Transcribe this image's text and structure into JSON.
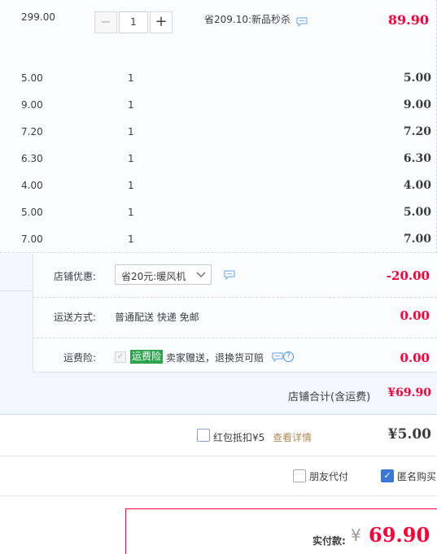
{
  "main_item": {
    "price": "299.00",
    "qty_minus": "−",
    "qty_value": "1",
    "qty_plus": "+",
    "promo": "省209.10:新品秒杀",
    "subtotal": "89.90"
  },
  "gift_items": [
    {
      "price": "5.00",
      "qty": "1",
      "subtotal": "5.00"
    },
    {
      "price": "9.00",
      "qty": "1",
      "subtotal": "9.00"
    },
    {
      "price": "7.20",
      "qty": "1",
      "subtotal": "7.20"
    },
    {
      "price": "6.30",
      "qty": "1",
      "subtotal": "6.30"
    },
    {
      "price": "4.00",
      "qty": "1",
      "subtotal": "4.00"
    },
    {
      "price": "5.00",
      "qty": "1",
      "subtotal": "5.00"
    },
    {
      "price": "7.00",
      "qty": "1",
      "subtotal": "7.00"
    }
  ],
  "shop": {
    "discount_label": "店铺优惠:",
    "discount_select": "省20元:暖风机",
    "discount_amount": "-20.00",
    "shipping_label": "运送方式:",
    "shipping_value": "普通配送 快递 免邮",
    "shipping_amount": "0.00",
    "insurance_label": "运费险:",
    "insurance_badge": "运费险",
    "insurance_text": "卖家赠送，退换货可赔",
    "insurance_amount": "0.00",
    "total_label": "店铺合计(含运费)",
    "total_value": "¥69.90"
  },
  "red_packet": {
    "label": "红包抵扣¥5",
    "link": "查看详情",
    "amount": "¥5.00"
  },
  "options": {
    "friend_pay": "朋友代付",
    "anonymous": "匿名购买"
  },
  "payment": {
    "label": "实付款:",
    "currency": "¥",
    "value": "69.90"
  },
  "colors": {
    "accent_red": "#ff0036",
    "badge_green": "#2da44e",
    "link_brown": "#b08a5a"
  }
}
